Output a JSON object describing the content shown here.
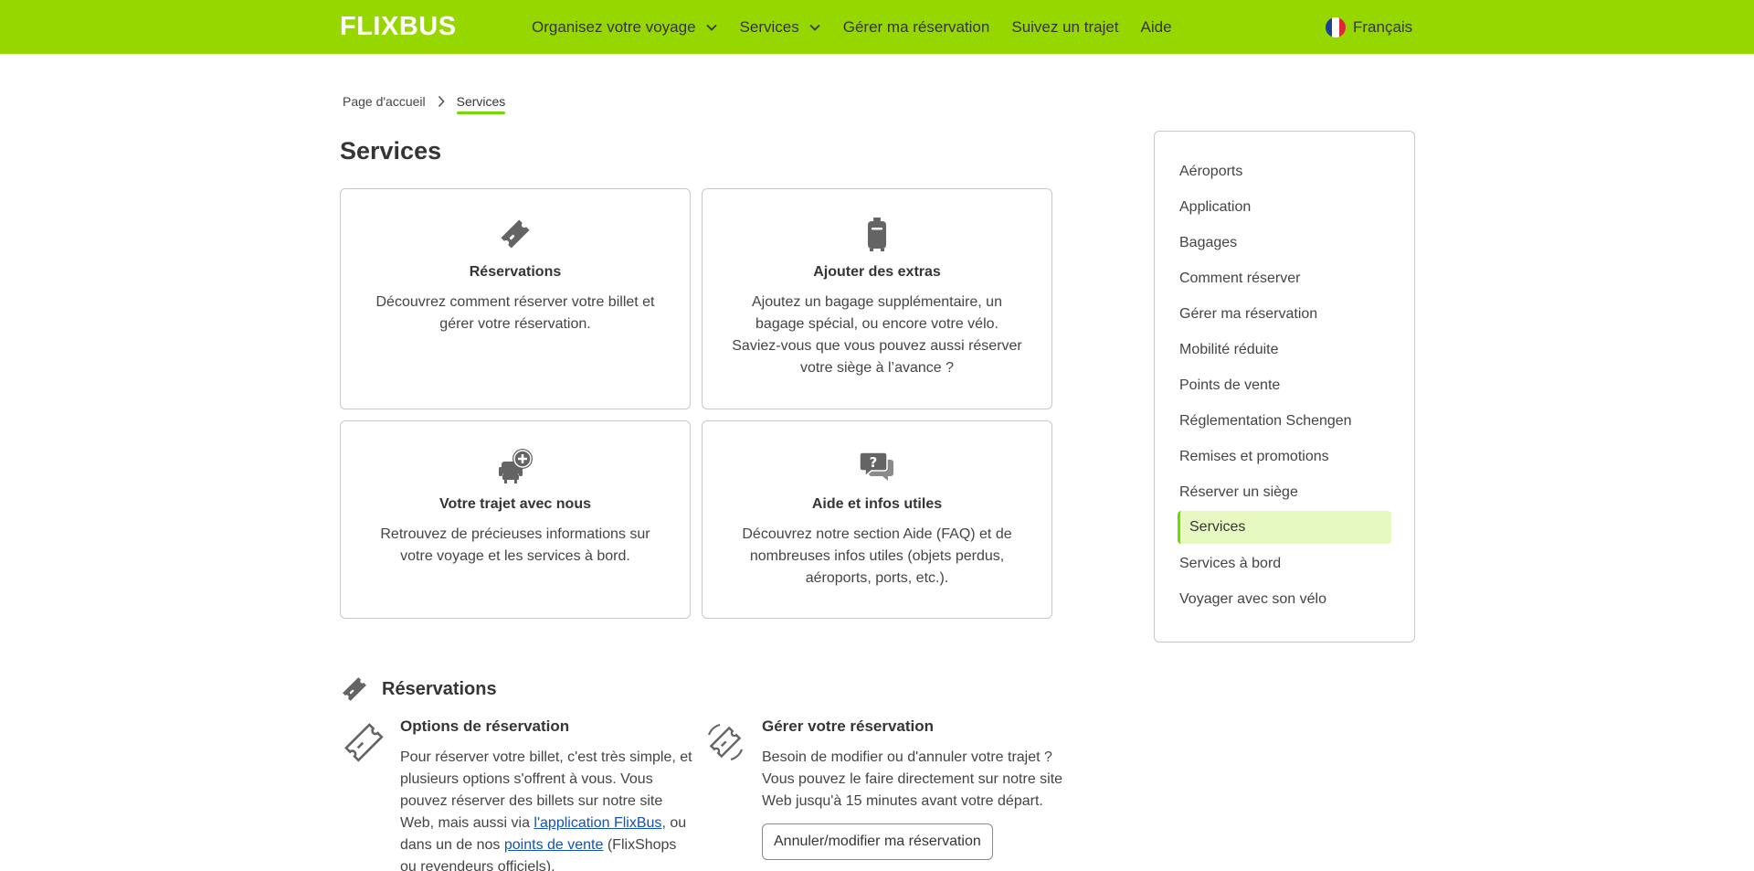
{
  "header": {
    "logo": "FLIXBUS",
    "nav": [
      "Organisez votre voyage",
      "Services",
      "Gérer ma réservation",
      "Suivez un trajet",
      "Aide"
    ],
    "language": "Français",
    "accent_color": "#97d700"
  },
  "breadcrumb": {
    "home": "Page d'accueil",
    "current": "Services"
  },
  "page_title": "Services",
  "cards": [
    {
      "icon": "ticket-icon",
      "title": "Réservations",
      "text": "Découvrez comment réserver votre billet et gérer votre réservation."
    },
    {
      "icon": "luggage-icon",
      "title": "Ajouter des extras",
      "text": "Ajoutez un bagage supplémentaire, un bagage spécial, ou encore votre vélo. Saviez-vous que vous pouvez aussi réserver votre siège à l’avance ?"
    },
    {
      "icon": "seat-plus-icon",
      "title": "Votre trajet avec nous",
      "text": "Retrouvez de précieuses informations sur votre voyage et les services à bord."
    },
    {
      "icon": "help-chat-icon",
      "title": "Aide et infos utiles",
      "text": "Découvrez notre section Aide (FAQ) et de nombreuses infos utiles (objets perdus, aéroports, ports, etc.)."
    }
  ],
  "sidebar": {
    "items": [
      "Aéroports",
      "Application",
      "Bagages",
      "Comment réserver",
      "Gérer ma réservation",
      "Mobilité réduite",
      "Points de vente",
      "Réglementation Schengen",
      "Remises et promotions",
      "Réserver un siège",
      "Services",
      "Services à bord",
      "Voyager avec son vélo"
    ],
    "active": "Services"
  },
  "section": {
    "title": "Réservations",
    "left": {
      "title": "Options de réservation",
      "text_1": "Pour réserver votre billet, c'est très simple, et plusieurs options s'offrent à vous. Vous pouvez réserver des billets sur notre site Web, mais aussi via ",
      "link_1": "l'application FlixBus",
      "text_2": ", ou dans un de nos ",
      "link_2": "points de vente",
      "text_3": " (FlixShops ou revendeurs officiels)."
    },
    "right": {
      "title": "Gérer votre réservation",
      "text": "Besoin de modifier ou d'annuler votre trajet ? Vous pouvez le faire directement sur notre site Web jusqu'à 15 minutes avant votre départ.",
      "button": "Annuler/modifier ma réservation"
    }
  }
}
